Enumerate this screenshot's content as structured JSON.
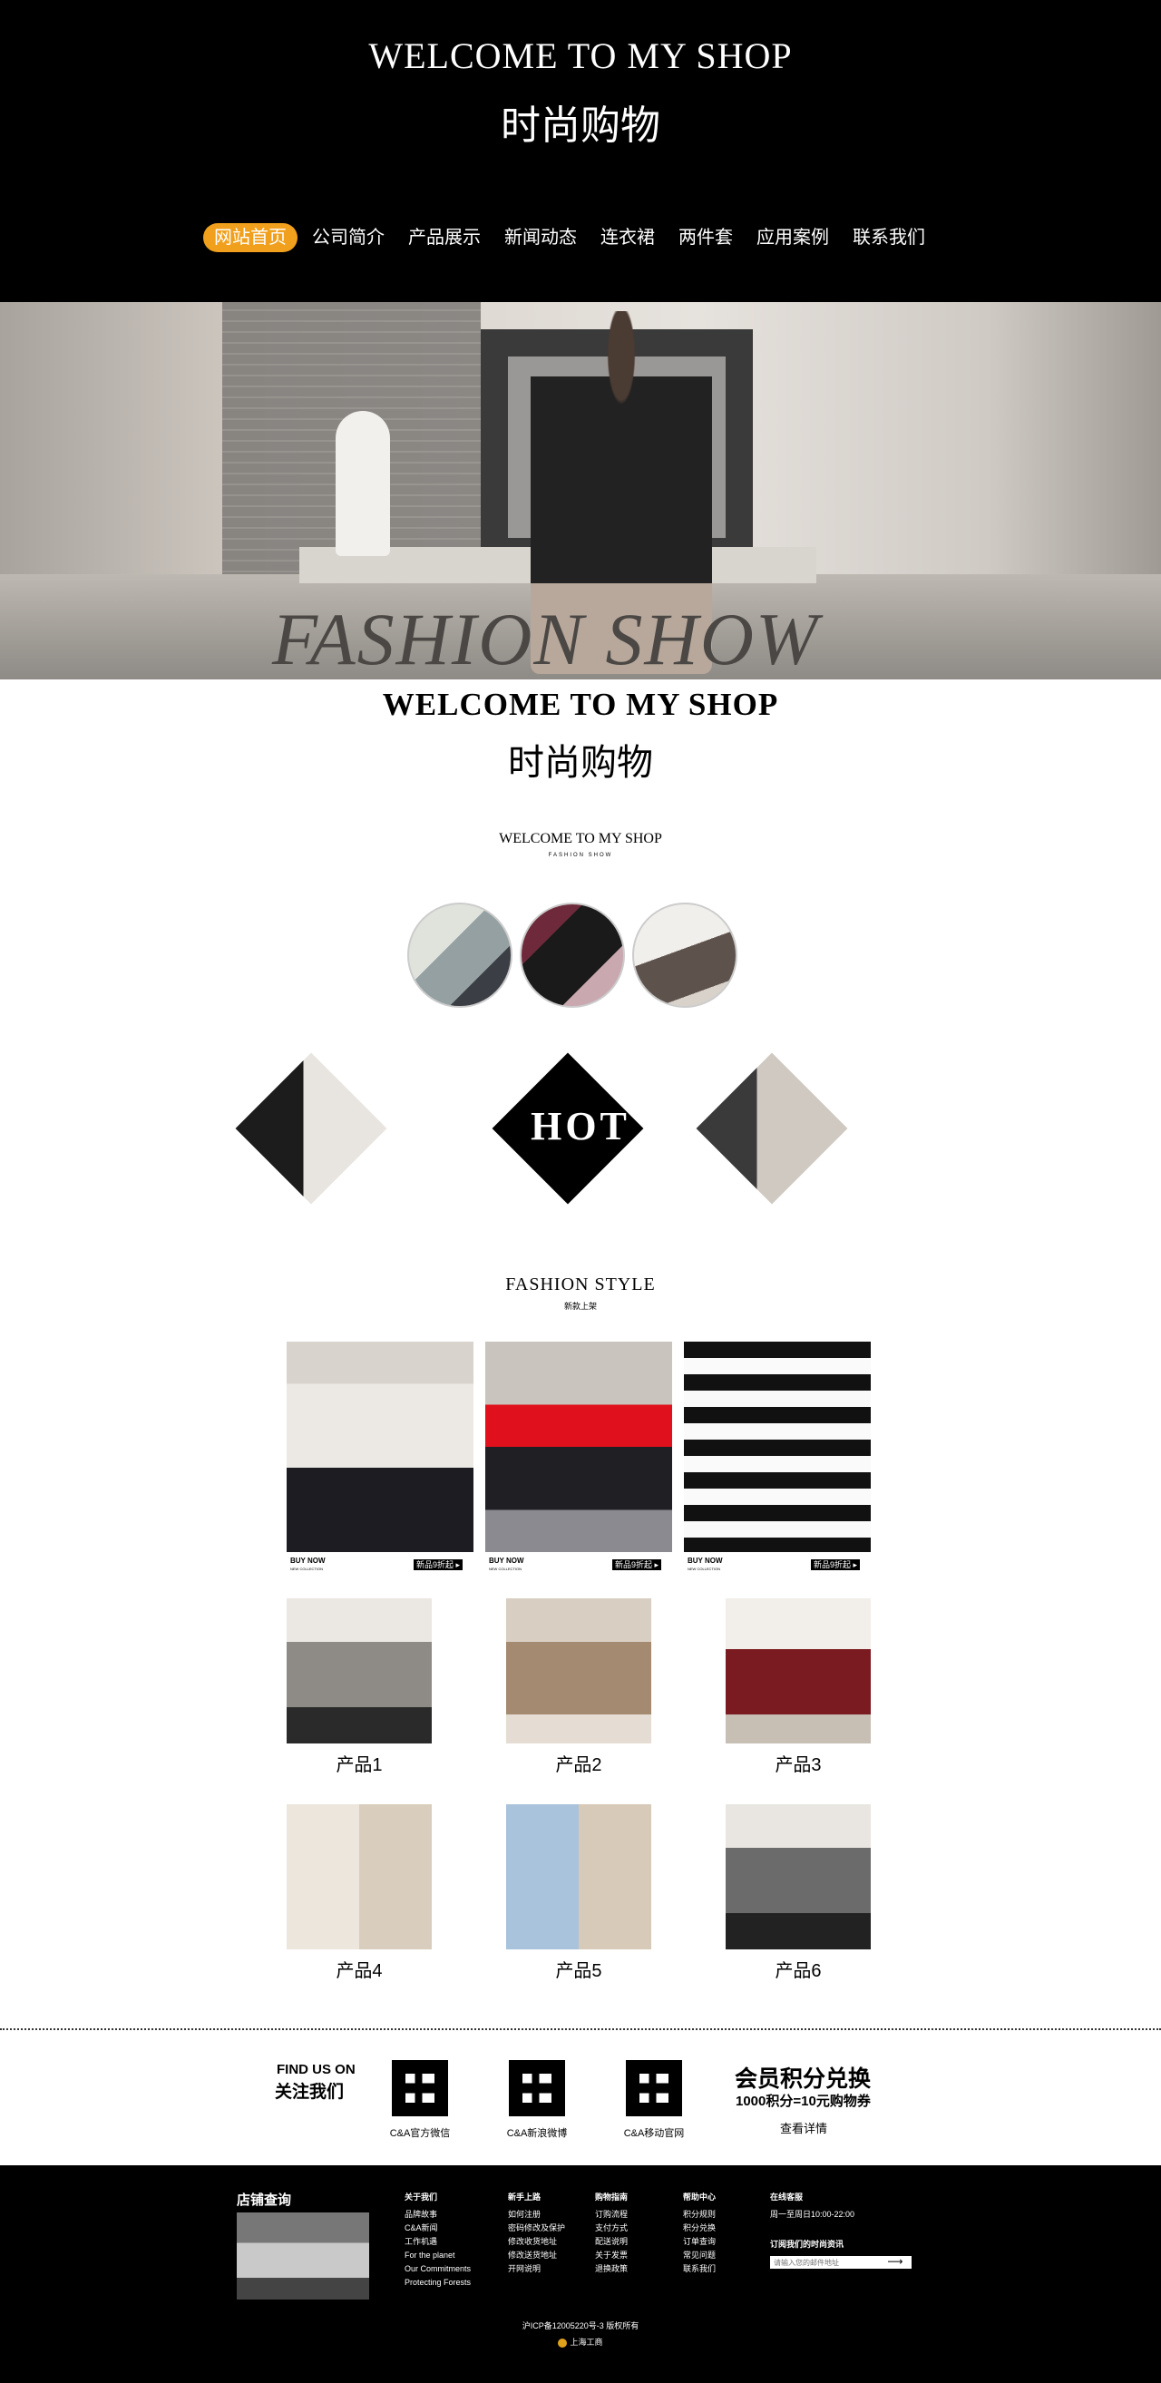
{
  "header": {
    "title_en": "WELCOME TO MY SHOP",
    "title_cn": "时尚购物",
    "nav": [
      {
        "label": "网站首页",
        "active": true
      },
      {
        "label": "公司简介"
      },
      {
        "label": "产品展示"
      },
      {
        "label": "新闻动态"
      },
      {
        "label": "连衣裙"
      },
      {
        "label": "两件套"
      },
      {
        "label": "应用案例"
      },
      {
        "label": "联系我们"
      }
    ],
    "nav_active_color": "#f0a01c"
  },
  "banner": {
    "text": "FASHION SHOW"
  },
  "welcome": {
    "title_en": "WELCOME TO MY SHOP",
    "title_cn": "时尚购物",
    "small_title": "WELCOME TO MY SHOP",
    "tiny_sub": "FASHION SHOW"
  },
  "hot": {
    "label": "HOT"
  },
  "fashion_style": {
    "title": "FASHION STYLE",
    "subtitle": "新款上架",
    "cards": [
      {
        "buy": "BUY NOW",
        "collection": "NEW COLLECTION",
        "tag": "新品9折起 ▸"
      },
      {
        "buy": "BUY NOW",
        "collection": "NEW COLLECTION",
        "tag": "新品9折起 ▸"
      },
      {
        "buy": "BUY NOW",
        "collection": "NEW COLLECTION",
        "tag": "新品9折起 ▸"
      }
    ]
  },
  "products": [
    {
      "name": "产品1"
    },
    {
      "name": "产品2"
    },
    {
      "name": "产品3"
    },
    {
      "name": "产品4"
    },
    {
      "name": "产品5"
    },
    {
      "name": "产品6"
    }
  ],
  "follow": {
    "find_us_en": "FIND US ON",
    "find_us_cn": "关注我们",
    "qr_labels": [
      "C&A官方微信",
      "C&A新浪微博",
      "C&A移动官网"
    ],
    "points_title": "会员积分兑换",
    "points_desc": "1000积分=10元购物券",
    "points_link": "查看详情"
  },
  "footer": {
    "store_title": "店铺查询",
    "columns": [
      {
        "head": "关于我们",
        "items": [
          "品牌故事",
          "C&A新闻",
          "工作机遇",
          "For the planet",
          "Our Commitments",
          "Protecting Forests"
        ]
      },
      {
        "head": "新手上路",
        "items": [
          "如何注册",
          "密码修改及保护",
          "修改收货地址",
          "修改送货地址",
          "开网说明"
        ]
      },
      {
        "head": "购物指南",
        "items": [
          "订购流程",
          "支付方式",
          "配送说明",
          "关于发票",
          "退换政策"
        ]
      },
      {
        "head": "帮助中心",
        "items": [
          "积分规则",
          "积分兑换",
          "订单查询",
          "常见问题",
          "联系我们"
        ]
      },
      {
        "head": "在线客服",
        "items": [
          "周一至周日10:00-22:00"
        ]
      }
    ],
    "subscribe_title": "订阅我们的时尚资讯",
    "subscribe_placeholder": "请输入您的邮件地址",
    "subscribe_btn": "⟶",
    "icp": "沪ICP备12005220号-3  版权所有",
    "gov": "上海工商"
  }
}
